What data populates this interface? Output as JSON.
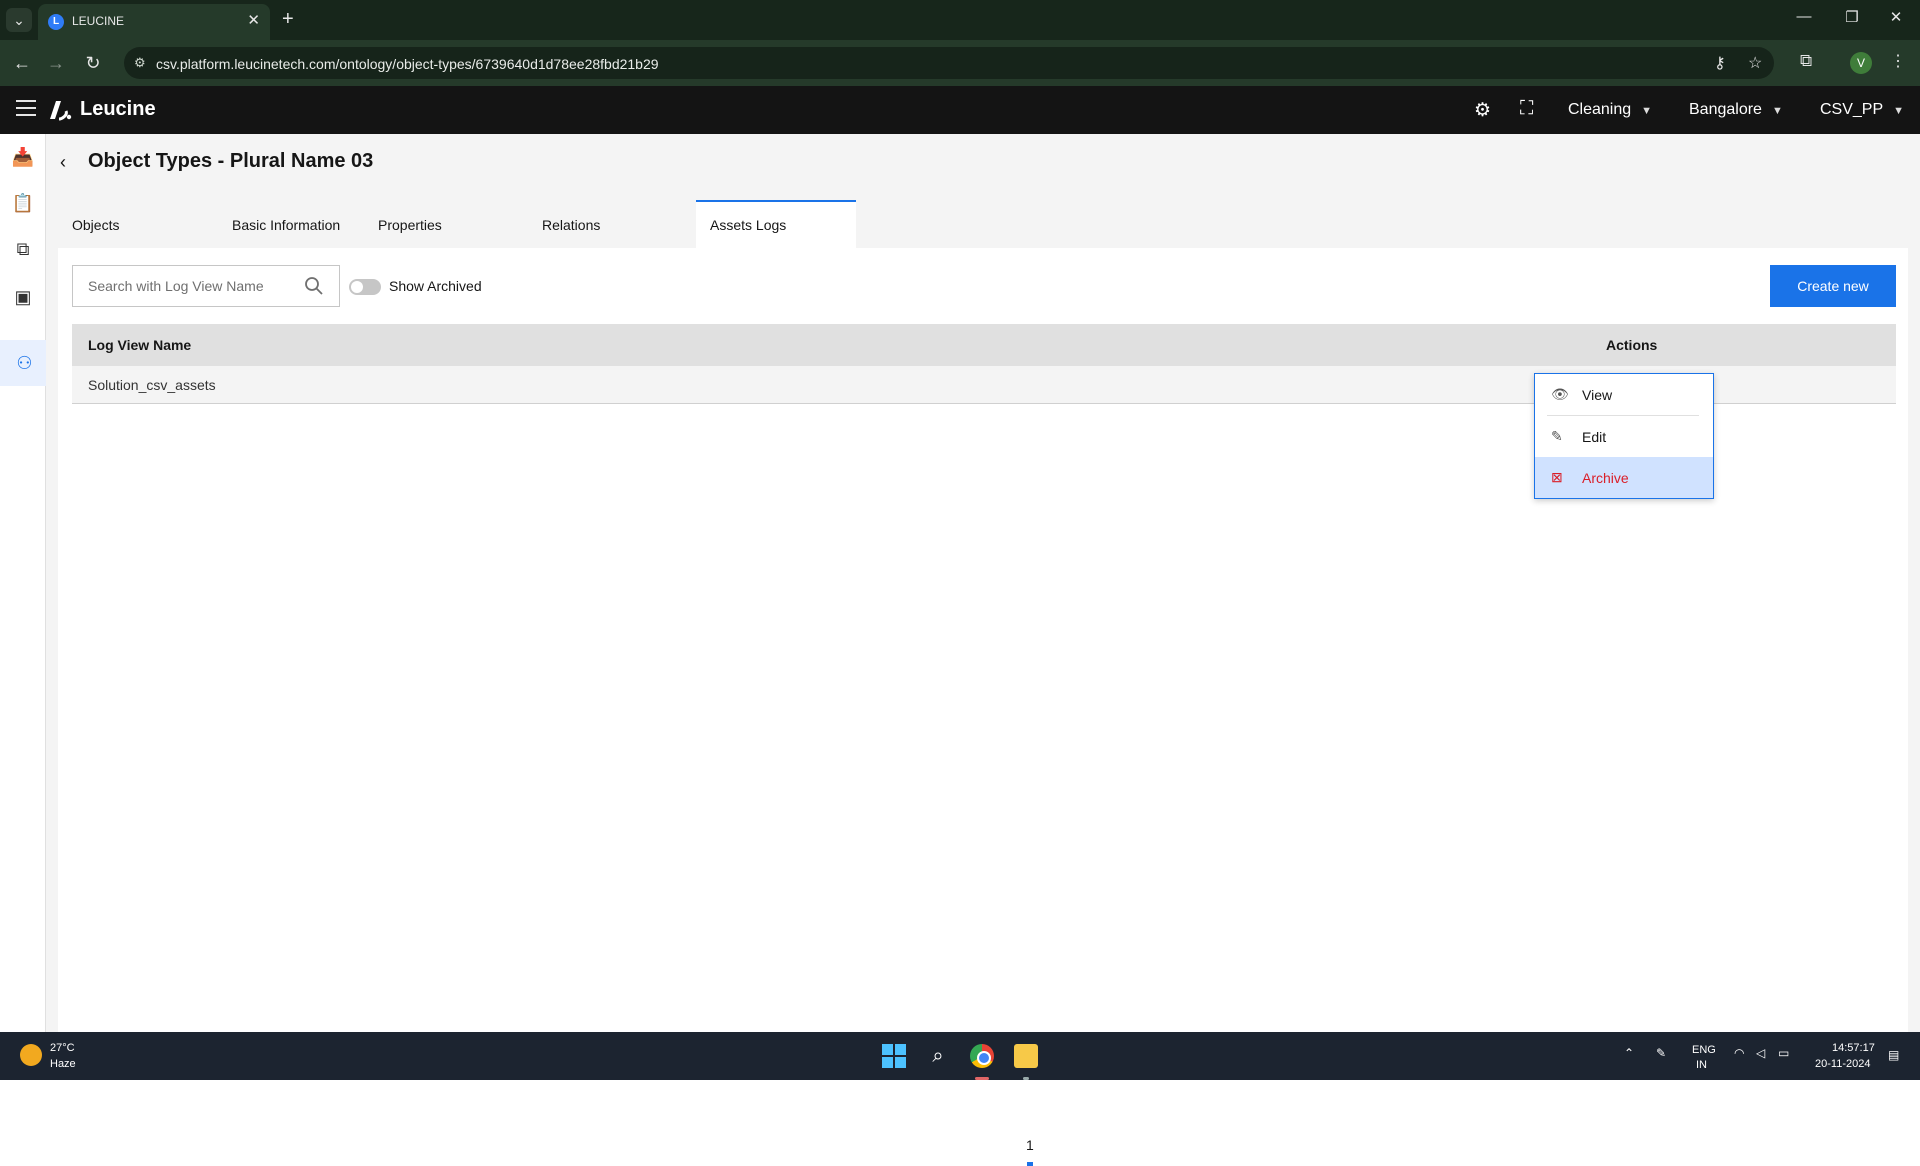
{
  "browser": {
    "tab_title": "LEUCINE",
    "url": "csv.platform.leucinetech.com/ontology/object-types/6739640d1d78ee28fbd21b29",
    "profile_initial": "V"
  },
  "app": {
    "logo_text": "Leucine",
    "header": {
      "dropdown_1": "Cleaning",
      "dropdown_2": "Bangalore",
      "dropdown_3": "CSV_PP"
    },
    "page_title": "Object Types - Plural Name 03",
    "tabs": [
      {
        "label": "Objects"
      },
      {
        "label": "Basic Information"
      },
      {
        "label": "Properties"
      },
      {
        "label": "Relations"
      },
      {
        "label": "Assets Logs"
      }
    ],
    "active_tab": "Assets Logs",
    "search": {
      "placeholder": "Search with Log View Name",
      "value": ""
    },
    "toggle_label": "Show Archived",
    "create_button": "Create new",
    "table": {
      "columns": [
        "Log View Name",
        "Actions"
      ],
      "rows": [
        {
          "name": "Solution_csv_assets"
        }
      ]
    },
    "actions_menu": {
      "items": [
        {
          "label": "View",
          "icon": "eye-icon"
        },
        {
          "label": "Edit",
          "icon": "pencil-icon"
        },
        {
          "label": "Archive",
          "icon": "archive-icon"
        }
      ]
    },
    "pagination": {
      "current_page": "1"
    }
  },
  "taskbar": {
    "weather_temp": "27°C",
    "weather_desc": "Haze",
    "lang_1": "ENG",
    "lang_2": "IN",
    "time": "14:57:17",
    "date": "20-11-2024"
  },
  "colors": {
    "accent": "#1a73e8",
    "danger": "#da1e28",
    "header_bg": "#141414"
  }
}
